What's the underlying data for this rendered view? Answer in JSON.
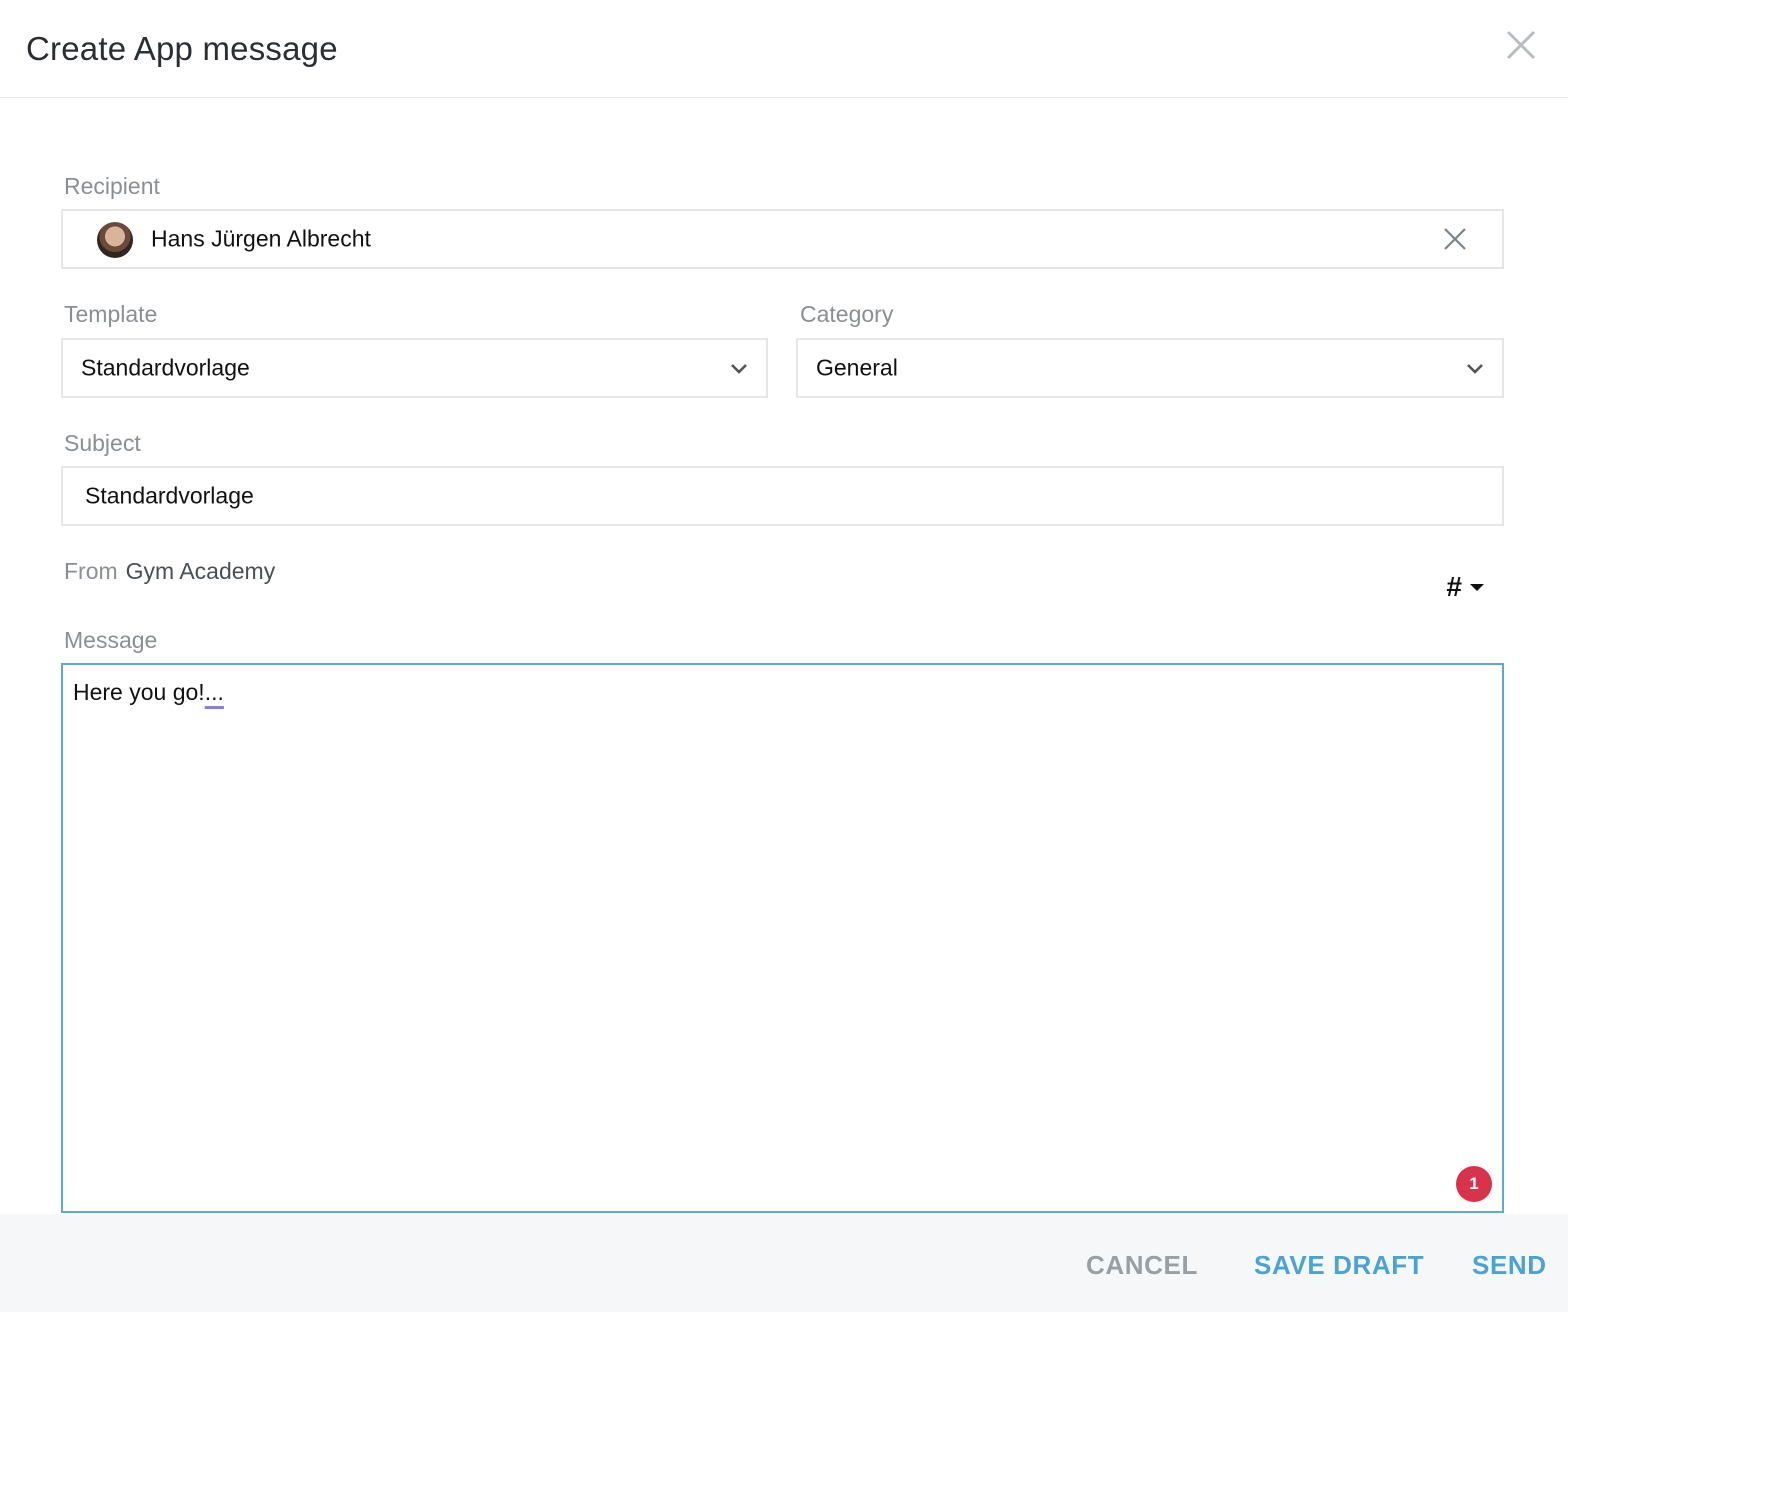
{
  "dialog": {
    "title": "Create App message"
  },
  "recipient": {
    "label": "Recipient",
    "name": "Hans Jürgen Albrecht"
  },
  "template": {
    "label": "Template",
    "value": "Standardvorlage"
  },
  "category": {
    "label": "Category",
    "value": "General"
  },
  "subject": {
    "label": "Subject",
    "value": "Standardvorlage"
  },
  "from": {
    "label": "From",
    "value": "Gym Academy"
  },
  "placeholder_menu": {
    "symbol": "#"
  },
  "message": {
    "label": "Message",
    "text": "Here you go!",
    "trailing": "..."
  },
  "notification_badge": {
    "count": "1"
  },
  "footer": {
    "cancel_label": "CANCEL",
    "save_draft_label": "SAVE DRAFT",
    "send_label": "SEND"
  },
  "colors": {
    "accent": "#4aa3d4",
    "badge": "#d9334b",
    "message_border": "#5aa9d6"
  }
}
